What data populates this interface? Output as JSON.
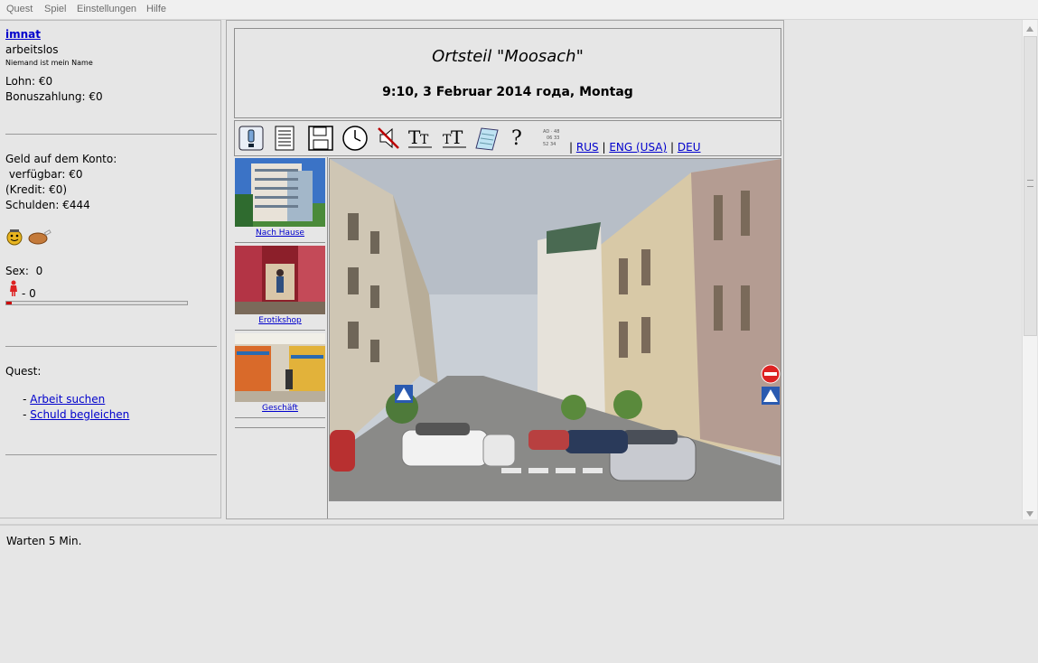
{
  "menu": {
    "items": [
      "Quest",
      "Spiel",
      "Einstellungen",
      "Hilfe"
    ]
  },
  "player": {
    "name": "imnat",
    "job": "arbeitslos",
    "subtitle": "Niemand ist mein Name",
    "wage": "Lohn: €0",
    "bonus": "Bonuszahlung: €0"
  },
  "account": {
    "heading": "Geld auf dem Konto:",
    "available": " verfügbar: €0",
    "credit": "(Kredit: €0)",
    "debt": "Schulden: €444"
  },
  "stats": {
    "sex": "Sex:  0",
    "figure": "- 0",
    "progress": 0.03
  },
  "quests": {
    "heading": "Quest:",
    "items": [
      {
        "prefix": " - ",
        "label": "Arbeit suchen"
      },
      {
        "prefix": " - ",
        "label": "Schuld begleichen"
      }
    ]
  },
  "location": {
    "title": "Ortsteil \"Moosach\"",
    "datetime": "9:10, 3 Februar 2014 года, Montag"
  },
  "languages": {
    "sep": "|",
    "items": [
      "RUS",
      "ENG (USA)",
      "DEU"
    ]
  },
  "places": [
    {
      "label": "Nach Hause"
    },
    {
      "label": "Erotikshop"
    },
    {
      "label": "Geschäft"
    }
  ],
  "status": {
    "text": "Warten 5 Min."
  },
  "icons": [
    "info-icon",
    "list-icon",
    "save-icon",
    "clock-icon",
    "sound-off-icon",
    "font-larger-icon",
    "font-smaller-icon",
    "notepad-icon",
    "help-icon",
    "calendar-icon"
  ]
}
